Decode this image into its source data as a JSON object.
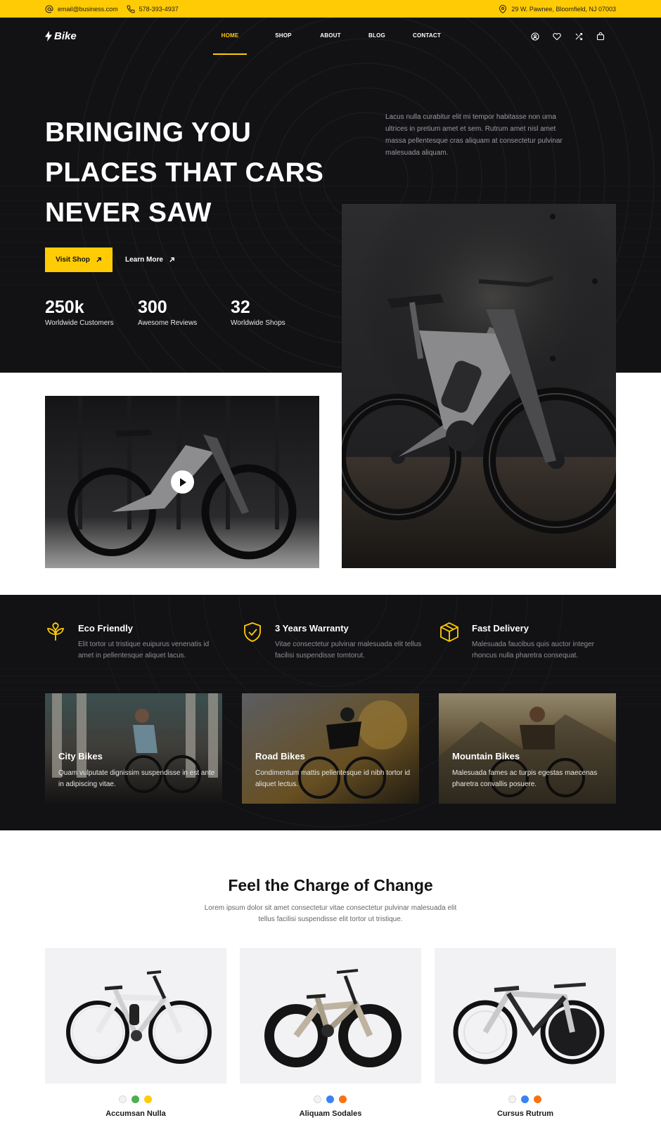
{
  "topbar": {
    "email": "email@business.com",
    "phone": "578-393-4937",
    "address": "29 W. Pawnee, Bloomfield, NJ 07003",
    "icons": [
      "at-icon",
      "phone-icon",
      "map-pin-icon"
    ]
  },
  "nav": {
    "logo": "Bike",
    "items": [
      {
        "label": "HOME",
        "active": true
      },
      {
        "label": "SHOP",
        "active": false
      },
      {
        "label": "ABOUT",
        "active": false
      },
      {
        "label": "BLOG",
        "active": false
      },
      {
        "label": "CONTACT",
        "active": false
      }
    ],
    "icons": [
      "user-icon",
      "heart-icon",
      "shuffle-icon",
      "bag-icon"
    ]
  },
  "hero": {
    "title_lines": [
      "BRINGING YOU",
      "PLACES THAT CARS",
      "NEVER SAW"
    ],
    "description": "Lacus nulla curabitur elit mi tempor habitasse non urna ultrices in pretium amet et sem. Rutrum amet nisl amet massa pellentesque cras aliquam at consectetur pulvinar malesuada aliquam.",
    "primary_button": "Visit Shop",
    "secondary_button": "Learn More",
    "stats": [
      {
        "value": "250k",
        "label": "Worldwide Customers"
      },
      {
        "value": "300",
        "label": "Awesome Reviews"
      },
      {
        "value": "32",
        "label": "Worldwide Shops"
      }
    ]
  },
  "features": [
    {
      "icon": "leaf-icon",
      "title": "Eco Friendly",
      "description": "Elit tortor ut tristique euipurus venenatis id amet in pellentesque aliquet lacus."
    },
    {
      "icon": "shield-check-icon",
      "title": "3 Years Warranty",
      "description": "Vitae consectetur pulvinar malesuada elit tellus facilisi suspendisse tomtorut."
    },
    {
      "icon": "box-icon",
      "title": "Fast Delivery",
      "description": "Malesuada faucibus quis auctor integer rhoncus nulla pharetra consequat."
    }
  ],
  "categories": [
    {
      "title": "City Bikes",
      "description": "Quam vulputate dignissim suspendisse in est ante in adipiscing vitae."
    },
    {
      "title": "Road Bikes",
      "description": "Condimentum mattis pellentesque id nibh tortor id aliquet lectus."
    },
    {
      "title": "Mountain Bikes",
      "description": "Malesuada fames ac turpis egestas maecenas pharetra convallis posuere."
    }
  ],
  "products_section": {
    "title": "Feel the Charge of Change",
    "description": "Lorem ipsum dolor sit amet consectetur vitae consectetur pulvinar malesuada elit tellus facilisi suspendisse elit tortor ut tristique.",
    "products": [
      {
        "name": "Accumsan Nulla",
        "swatches": [
          "#f3f3f3",
          "#4caf50",
          "#ffcb05"
        ]
      },
      {
        "name": "Aliquam Sodales",
        "swatches": [
          "#f3f3f3",
          "#3b82f6",
          "#f97316"
        ]
      },
      {
        "name": "Cursus Rutrum",
        "swatches": [
          "#f3f3f3",
          "#3b82f6",
          "#f97316"
        ]
      }
    ]
  },
  "colors": {
    "accent": "#ffcb05",
    "dark": "#121215"
  }
}
